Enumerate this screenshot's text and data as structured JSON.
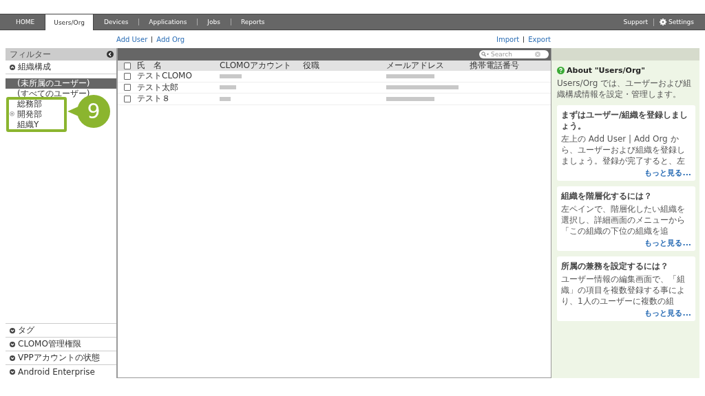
{
  "nav": {
    "tabs": [
      {
        "label": "HOME",
        "selected": false
      },
      {
        "label": "Users/Org",
        "selected": true
      },
      {
        "label": "Devices",
        "selected": false
      },
      {
        "label": "Applications",
        "selected": false
      },
      {
        "label": "Jobs",
        "selected": false
      },
      {
        "label": "Reports",
        "selected": false
      }
    ],
    "right": [
      {
        "label": "Support",
        "kind": "text"
      },
      {
        "label": "Settings",
        "kind": "gear"
      }
    ]
  },
  "actions_left": [
    "Add User",
    "Add Org"
  ],
  "actions_right": [
    "Import",
    "Export"
  ],
  "filter": {
    "title": "フィルター",
    "org_section": {
      "label": "組織構成",
      "expanded": true
    },
    "orgs": [
      {
        "label": "(未所属のユーザー)",
        "selected": true,
        "marked": false,
        "highlighted": false
      },
      {
        "label": "(すべてのユーザー)",
        "selected": false,
        "marked": false,
        "highlighted": false
      },
      {
        "label": "総務部",
        "selected": false,
        "marked": false,
        "highlighted": true
      },
      {
        "label": "開発部",
        "selected": false,
        "marked": true,
        "highlighted": true
      },
      {
        "label": "組織Y",
        "selected": false,
        "marked": false,
        "highlighted": true
      }
    ],
    "sections": [
      {
        "label": "タグ",
        "expanded": false
      },
      {
        "label": "CLOMO管理権限",
        "expanded": false
      },
      {
        "label": "VPPアカウントの状態",
        "expanded": false
      },
      {
        "label": "Android Enterprise",
        "expanded": false
      }
    ]
  },
  "callout": {
    "number": "9"
  },
  "table": {
    "search": {
      "placeholder": "Search"
    },
    "all_checked": false,
    "columns": [
      "氏　名",
      "CLOMOアカウント",
      "役職",
      "メールアドレス",
      "携帯電話番号"
    ],
    "rows": [
      {
        "name": "テストCLOMO",
        "checked": false,
        "account_redacted": true,
        "email_redacted": true
      },
      {
        "name": "テスト太郎",
        "checked": false,
        "account_redacted": true,
        "email_redacted": true
      },
      {
        "name": "テスト８",
        "checked": false,
        "account_redacted": true,
        "email_redacted": true
      }
    ]
  },
  "help": {
    "title": "About \"Users/Org\"",
    "intro": "Users/Org では、ユーザーおよび組織構成情報を設定・管理します。",
    "cards": [
      {
        "title": "まずはユーザー/組織を登録しましょう。",
        "body": "左上の Add User | Add Org から、ユーザーおよび組織を登録しましょう。登録が完了すると、左",
        "more": "もっと見る..."
      },
      {
        "title": "組織を階層化するには？",
        "body": "左ペインで、階層化したい組織を選択し、詳細画面のメニューから「この組織の下位の組織を追",
        "more": "もっと見る..."
      },
      {
        "title": "所属の兼務を設定するには？",
        "body": "ユーザー情報の編集画面で、「組織」の項目を複数登録する事により、1人のユーザーに複数の組",
        "more": "もっと見る..."
      }
    ]
  }
}
